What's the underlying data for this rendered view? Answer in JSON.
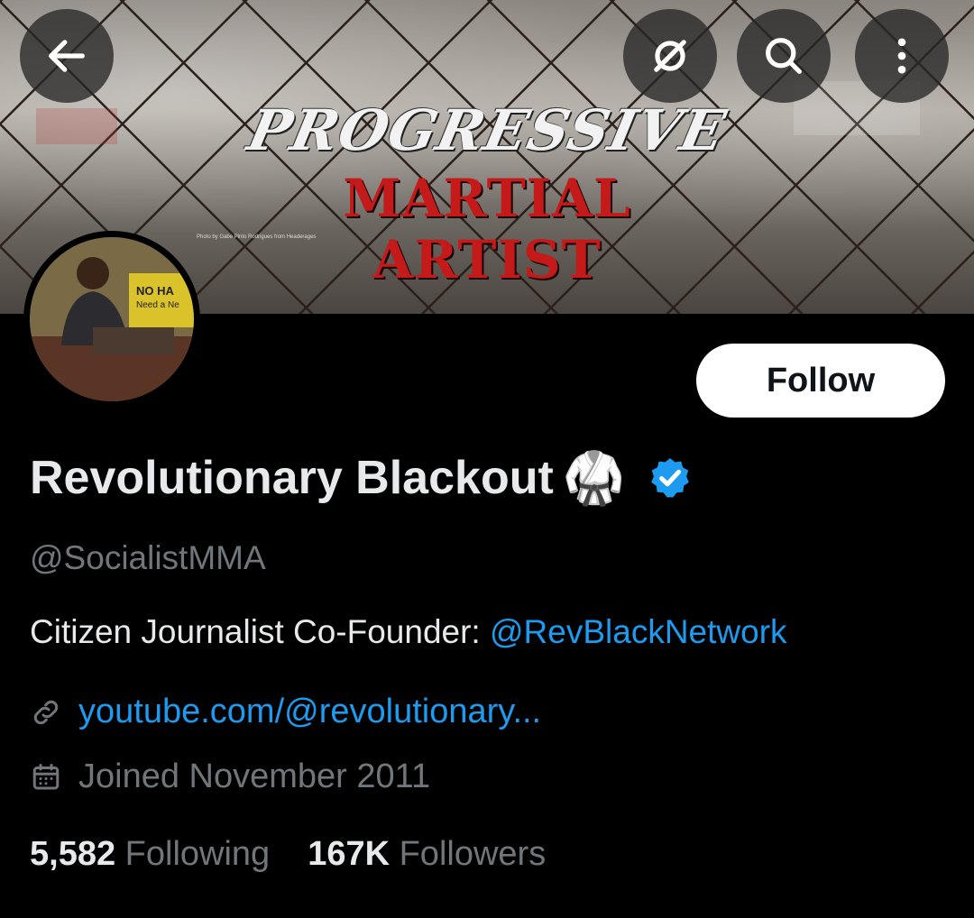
{
  "banner": {
    "title_line1": "PROGRESSIVE",
    "title_line2": "MARTIAL ARTIST",
    "credit": "Photo by Gabe Pinto Rodrigues from Headerages"
  },
  "topbar": {
    "back_icon": "arrow-left-icon",
    "grok_icon": "grok-icon",
    "search_icon": "search-icon",
    "more_icon": "more-vertical-icon"
  },
  "avatar": {
    "sign_text1": "NO HA",
    "sign_text2": "Need a Ne"
  },
  "follow": {
    "label": "Follow"
  },
  "profile": {
    "display_name": "Revolutionary Blackout",
    "name_emoji": "🥋",
    "handle": "@SocialistMMA",
    "bio_text": "Citizen Journalist Co-Founder: ",
    "bio_mention": "@RevBlackNetwork",
    "link": "youtube.com/@revolutionary...",
    "joined": "Joined November 2011"
  },
  "stats": {
    "following_count": "5,582",
    "following_label": "Following",
    "followers_count": "167K",
    "followers_label": "Followers"
  },
  "colors": {
    "accent": "#1d9bf0",
    "muted": "#71767b",
    "text": "#e7e9ea",
    "banner_red": "#c41a1a"
  }
}
